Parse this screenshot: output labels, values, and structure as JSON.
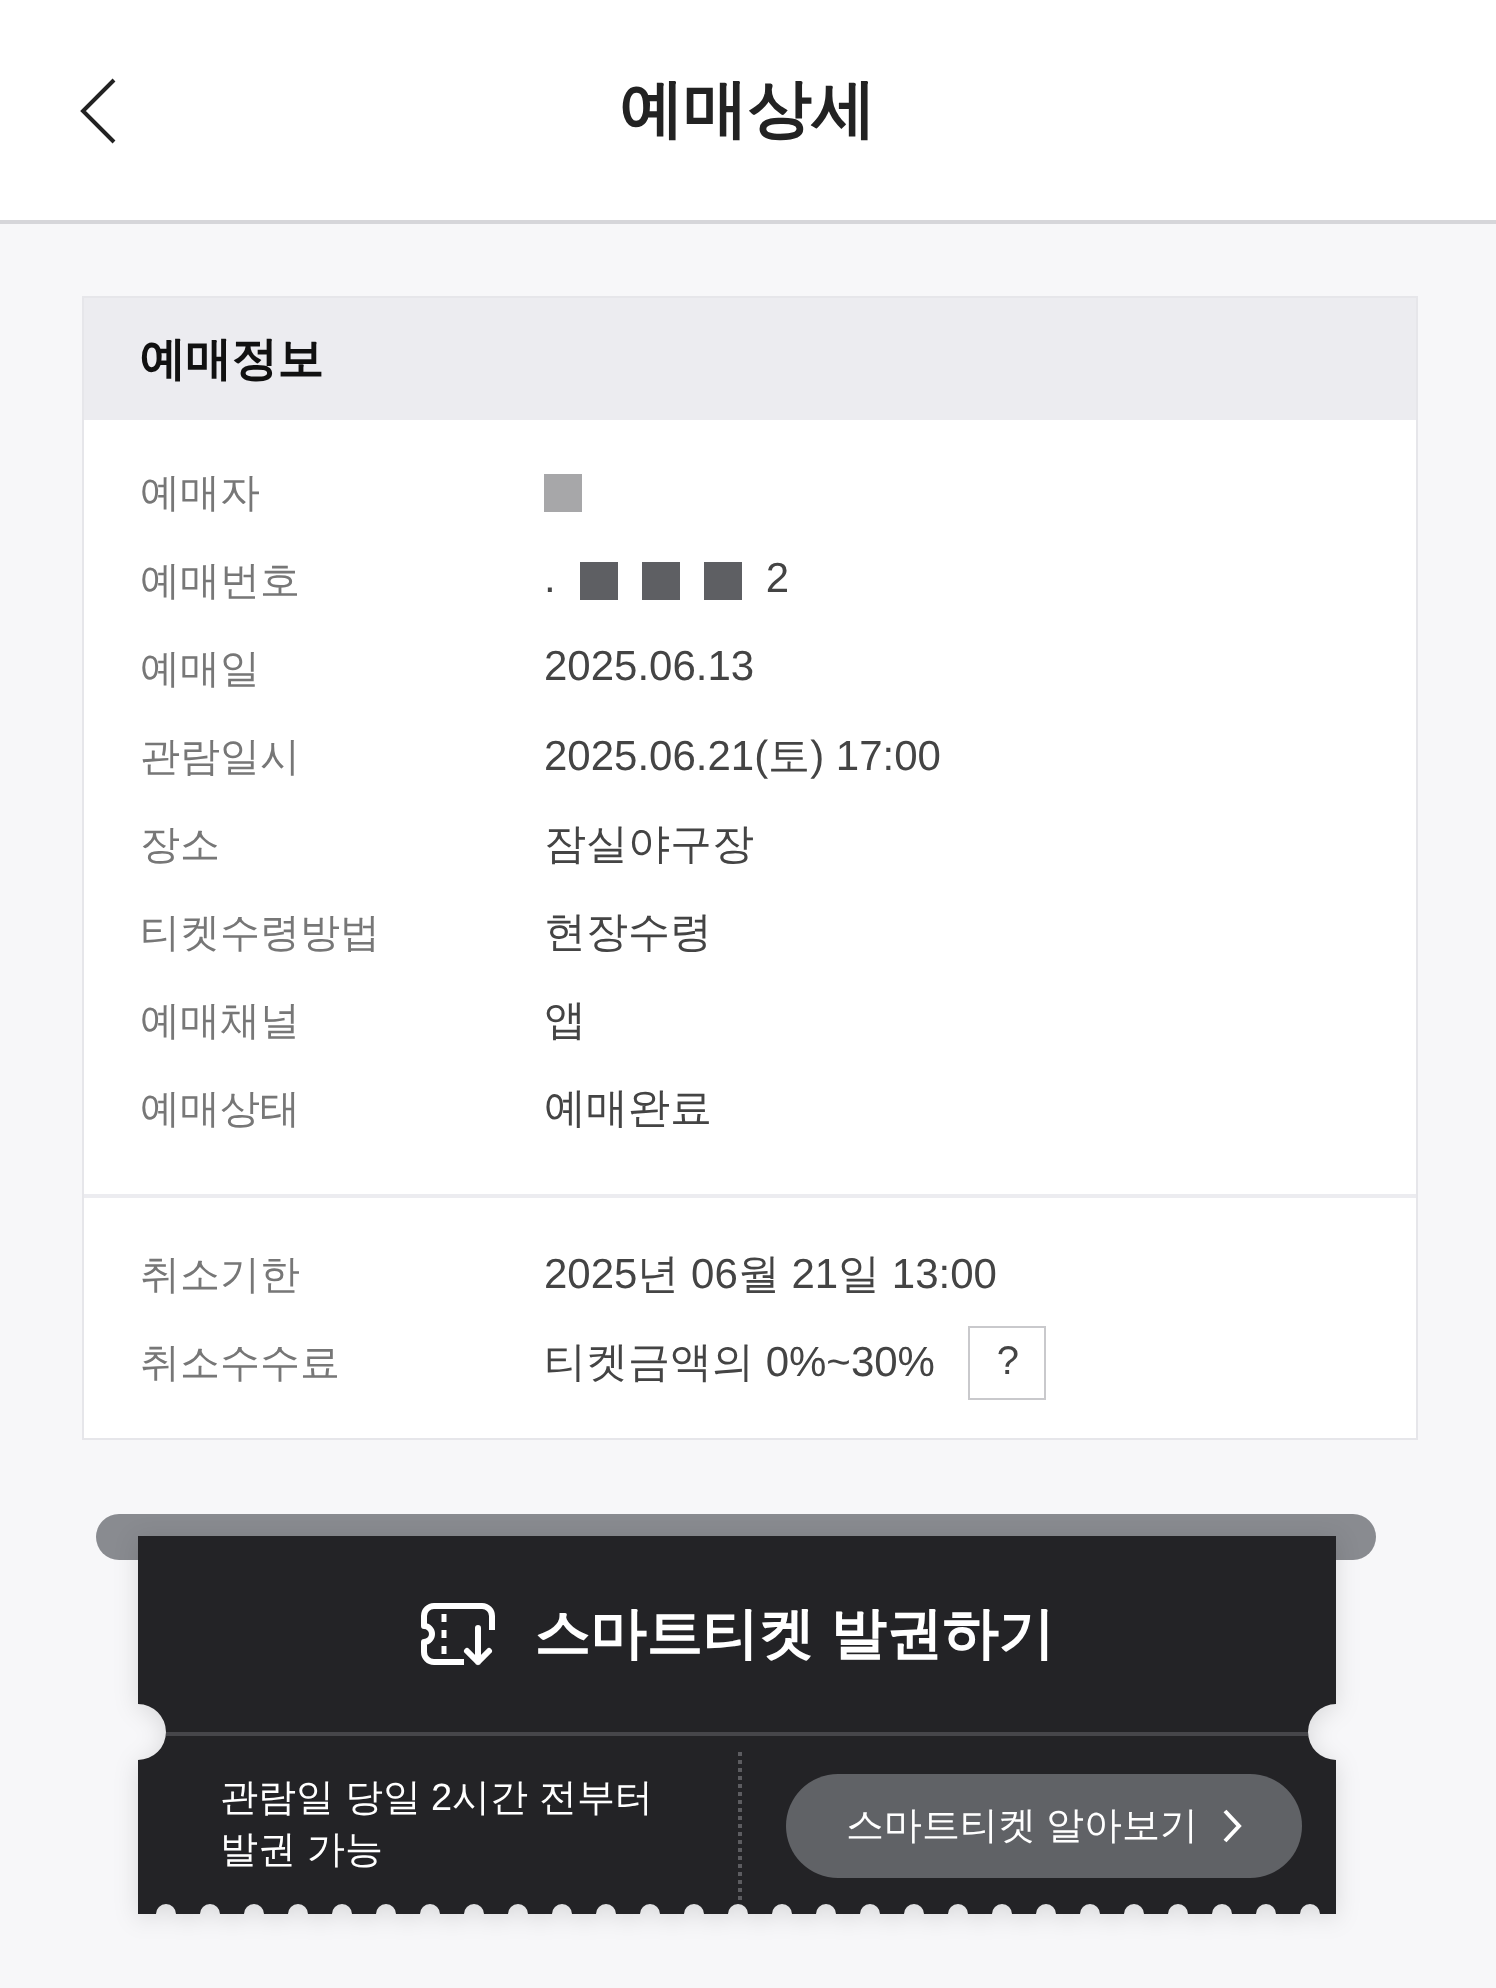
{
  "header": {
    "title": "예매상세"
  },
  "booking_info": {
    "title": "예매정보",
    "rows": [
      {
        "label": "예매자",
        "segments": [
          {
            "kind": "redaction",
            "color": "#a7a7a9"
          }
        ]
      },
      {
        "label": "예매번호",
        "segments": [
          {
            "kind": "text",
            "text": "."
          },
          {
            "kind": "redaction",
            "color": "#5e5f63"
          },
          {
            "kind": "redaction",
            "color": "#5e5f63"
          },
          {
            "kind": "redaction",
            "color": "#5e5f63"
          },
          {
            "kind": "text",
            "text": "2"
          }
        ]
      },
      {
        "label": "예매일",
        "segments": [
          {
            "kind": "text",
            "text": "2025.06.13"
          }
        ]
      },
      {
        "label": "관람일시",
        "segments": [
          {
            "kind": "text",
            "text": "2025.06.21(토) 17:00"
          }
        ]
      },
      {
        "label": "장소",
        "segments": [
          {
            "kind": "text",
            "text": "잠실야구장"
          }
        ]
      },
      {
        "label": "티켓수령방법",
        "segments": [
          {
            "kind": "text",
            "text": "현장수령"
          }
        ]
      },
      {
        "label": "예매채널",
        "segments": [
          {
            "kind": "text",
            "text": "앱"
          }
        ]
      },
      {
        "label": "예매상태",
        "segments": [
          {
            "kind": "text",
            "text": "예매완료"
          }
        ]
      }
    ],
    "cancel_rows": [
      {
        "label": "취소기한",
        "segments": [
          {
            "kind": "text",
            "text": "2025년 06월 21일 13:00"
          }
        ]
      },
      {
        "label": "취소수수료",
        "segments": [
          {
            "kind": "text",
            "text": "티켓금액의 0%~30%"
          }
        ],
        "help": "?"
      }
    ]
  },
  "smart_ticket": {
    "title": "스마트티켓 발권하기",
    "note": "관람일 당일 2시간 전부터\n발권 가능",
    "button": "스마트티켓 알아보기"
  }
}
